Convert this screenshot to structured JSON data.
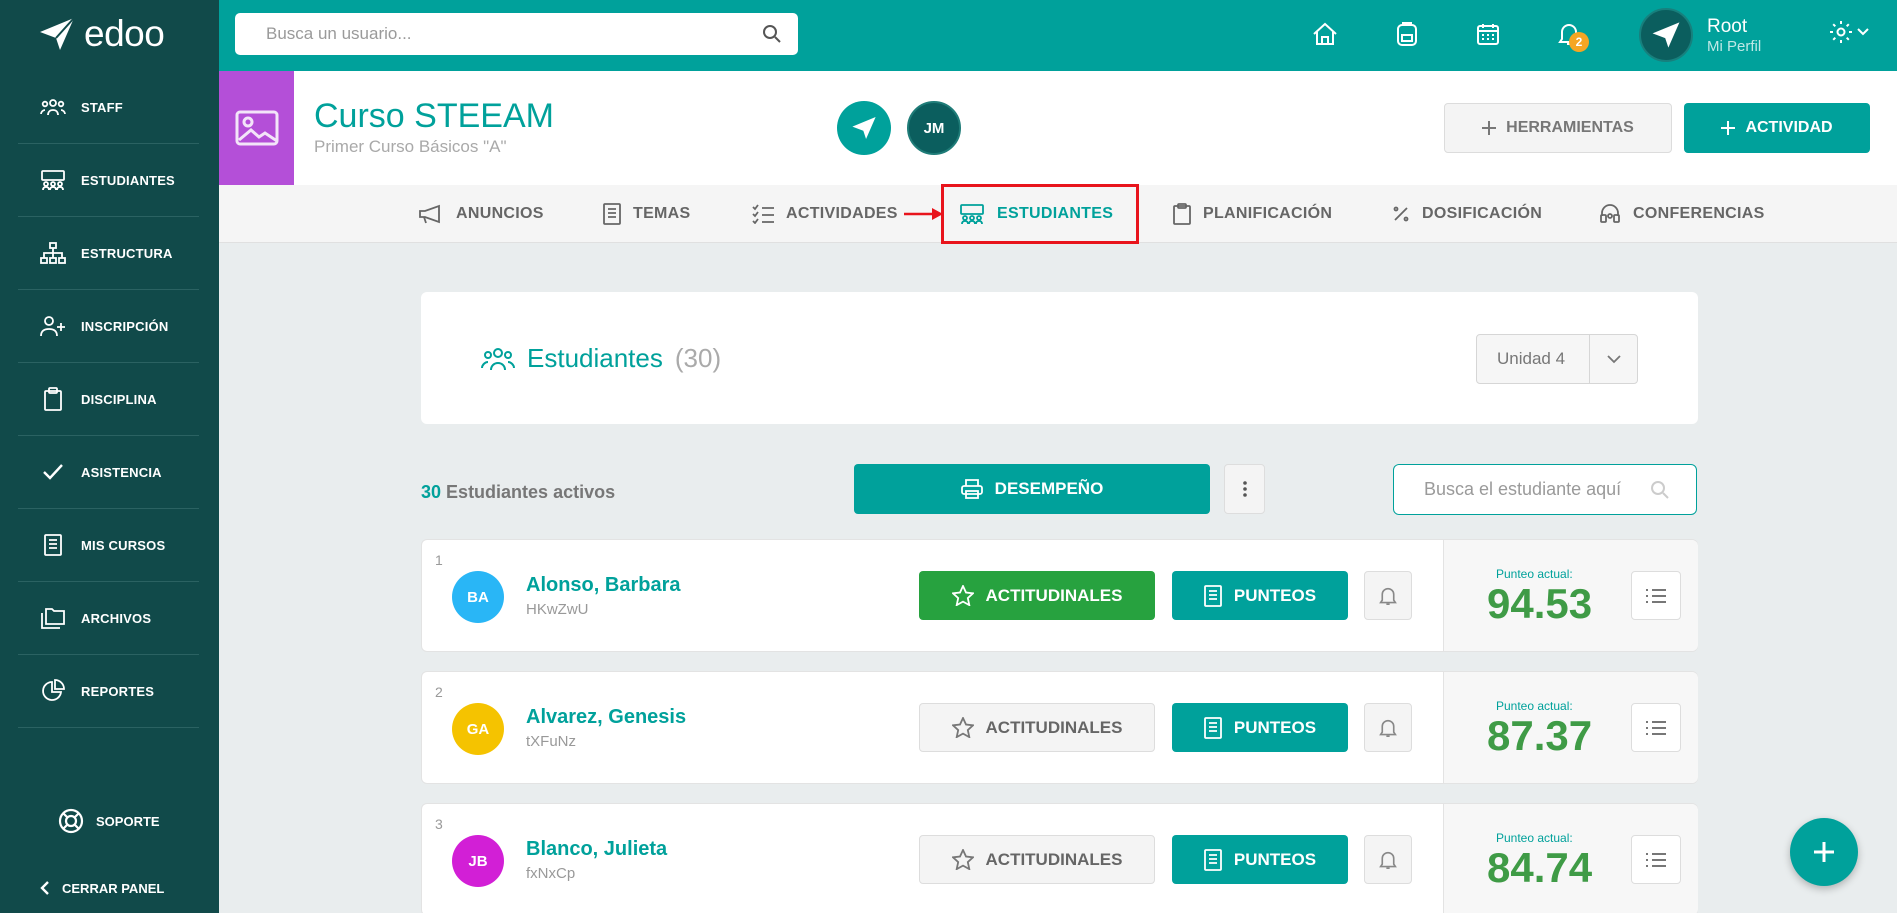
{
  "brand": {
    "name": "edoo"
  },
  "sidebar": {
    "items": [
      {
        "label": "STAFF",
        "icon": "staff-icon"
      },
      {
        "label": "ESTUDIANTES",
        "icon": "students-icon"
      },
      {
        "label": "ESTRUCTURA",
        "icon": "structure-icon"
      },
      {
        "label": "INSCRIPCIÓN",
        "icon": "add-user-icon"
      },
      {
        "label": "DISCIPLINA",
        "icon": "clipboard-icon"
      },
      {
        "label": "ASISTENCIA",
        "icon": "check-icon"
      },
      {
        "label": "MIS CURSOS",
        "icon": "book-icon"
      },
      {
        "label": "ARCHIVOS",
        "icon": "folders-icon"
      },
      {
        "label": "REPORTES",
        "icon": "pie-chart-icon"
      }
    ],
    "support_label": "SOPORTE",
    "close_label": "CERRAR PANEL"
  },
  "topbar": {
    "search_placeholder": "Busca un usuario...",
    "notifications_count": "2",
    "user_name": "Root",
    "user_sub": "Mi Perfil"
  },
  "course": {
    "title": "Curso STEEAM",
    "subtitle": "Primer Curso Básicos \"A\"",
    "avatar2_initials": "JM",
    "tools_label": "HERRAMIENTAS",
    "activity_label": "ACTIVIDAD"
  },
  "tabs": [
    {
      "label": "ANUNCIOS"
    },
    {
      "label": "TEMAS"
    },
    {
      "label": "ACTIVIDADES"
    },
    {
      "label": "ESTUDIANTES"
    },
    {
      "label": "PLANIFICACIÓN"
    },
    {
      "label": "DOSIFICACIÓN"
    },
    {
      "label": "CONFERENCIAS"
    }
  ],
  "students_card": {
    "title": "Estudiantes",
    "count": "(30)",
    "unit": "Unidad 4"
  },
  "toolbar": {
    "active_num": "30",
    "active_label": "Estudiantes activos",
    "performance_label": "DESEMPEÑO",
    "search_placeholder": "Busca el estudiante aquí"
  },
  "students": [
    {
      "num": "1",
      "initials": "BA",
      "name": "Alonso, Barbara",
      "code": "HKwZwU",
      "attitudinal": "ACTITUDINALES",
      "scores": "PUNTEOS",
      "score_label": "Punteo actual:",
      "score": "94.53",
      "attitudinal_active": true,
      "avatar_color": "#29b6f6"
    },
    {
      "num": "2",
      "initials": "GA",
      "name": "Alvarez, Genesis",
      "code": "tXFuNz",
      "attitudinal": "ACTITUDINALES",
      "scores": "PUNTEOS",
      "score_label": "Punteo actual:",
      "score": "87.37",
      "attitudinal_active": false,
      "avatar_color": "#f5c300"
    },
    {
      "num": "3",
      "initials": "JB",
      "name": "Blanco, Julieta",
      "code": "fxNxCp",
      "attitudinal": "ACTITUDINALES",
      "scores": "PUNTEOS",
      "score_label": "Punteo actual:",
      "score": "84.74",
      "attitudinal_active": false,
      "avatar_color": "#d21fd6"
    }
  ],
  "colors": {
    "primary": "#00a19b",
    "sidebar": "#114a4a",
    "success": "#27a23f",
    "highlight": "#e8141c"
  }
}
